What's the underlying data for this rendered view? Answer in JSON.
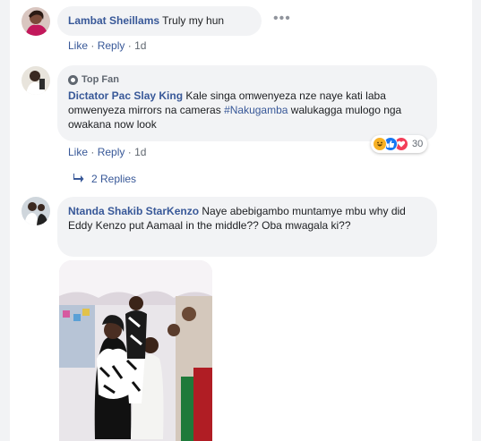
{
  "comments": [
    {
      "author": "Lambat Sheillams",
      "text": "Truly my hun",
      "like": "Like",
      "reply": "Reply",
      "time": "1d",
      "more_icon": "more-horizontal-icon"
    },
    {
      "badge": "Top Fan",
      "author": "Dictator Pac Slay King",
      "text_before": "Kale singa omwenyeza nze naye kati laba omwenyeza mirrors na cameras",
      "hashtag": "#Nakugamba",
      "text_after": "walukagga mulogo nga owakana now look",
      "like": "Like",
      "reply": "Reply",
      "time": "1d",
      "reactions": [
        "haha",
        "like",
        "love"
      ],
      "reaction_count": "30",
      "replies": "2 Replies"
    },
    {
      "author": "Ntanda Shakib StarKenzo",
      "text": "Naye abebigambo muntamye mbu why did Eddy Kenzo put Aamaal in the middle?? Oba mwagala ki??"
    }
  ],
  "colors": {
    "link": "#385898",
    "bubble": "#f2f3f5",
    "meta": "#606770"
  }
}
